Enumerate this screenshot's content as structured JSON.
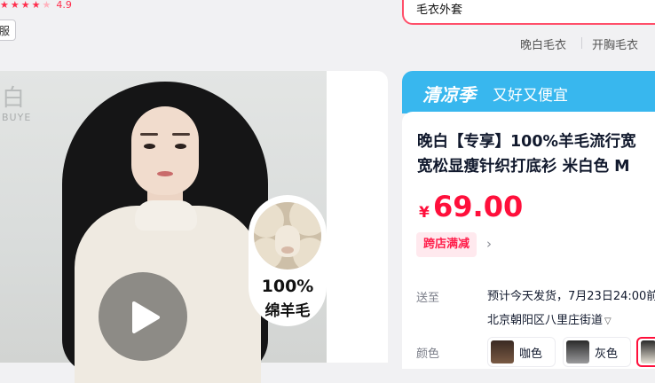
{
  "rating": {
    "score": "4.9",
    "stars": [
      "★",
      "★",
      "★",
      "★"
    ],
    "half_star": "★"
  },
  "service_chip": {
    "label": "服"
  },
  "search": {
    "query": "毛衣外套"
  },
  "suggestions": [
    {
      "label": "晚白毛衣"
    },
    {
      "label": "开胸毛衣"
    }
  ],
  "media": {
    "brand_mark": "白",
    "brand_sub": "BUYE",
    "play_icon": "play-icon",
    "badge": {
      "percent": "100%",
      "text": "绵羊毛"
    }
  },
  "promo": {
    "name": "清凉季",
    "slogan": "又好又便宜",
    "color": "#38b7ee"
  },
  "product": {
    "title_line1": "晚白【专享】100%羊毛流行宽",
    "title_line2": "宽松显瘦针织打底衫 米白色 M",
    "currency": "¥",
    "price": "69.00",
    "promo_tag": "跨店满减",
    "accent_color": "#ff0f3b"
  },
  "shipping": {
    "label": "送至",
    "estimate": "预计今天发货，7月23日24:00前",
    "address": "北京朝阳区八里庄街道"
  },
  "colors": {
    "label": "颜色",
    "options": [
      {
        "label": "咖色",
        "swatch": "#7a5a44"
      },
      {
        "label": "灰色",
        "swatch": "#9a9a9c"
      },
      {
        "label": "",
        "swatch": "#e8e2d6"
      }
    ]
  }
}
